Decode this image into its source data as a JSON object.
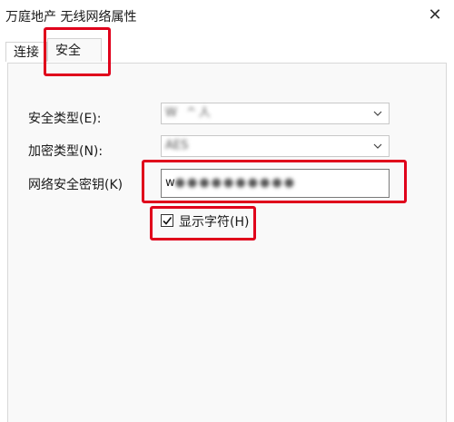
{
  "window": {
    "title": "万庭地产 无线网络属性",
    "close_glyph": "✕"
  },
  "tabs": [
    {
      "label": "连接",
      "active": false
    },
    {
      "label": "安全",
      "active": true
    }
  ],
  "fields": {
    "security_type": {
      "label": "安全类型(E):",
      "value": "W    ^ 人"
    },
    "encryption_type": {
      "label": "加密类型(N):",
      "value": "AES"
    },
    "network_key": {
      "label": "网络安全密钥(K)",
      "value": "w"
    }
  },
  "show_chars": {
    "label": "显示字符(H)",
    "checked": true
  },
  "annotation_color": "#e0001b"
}
